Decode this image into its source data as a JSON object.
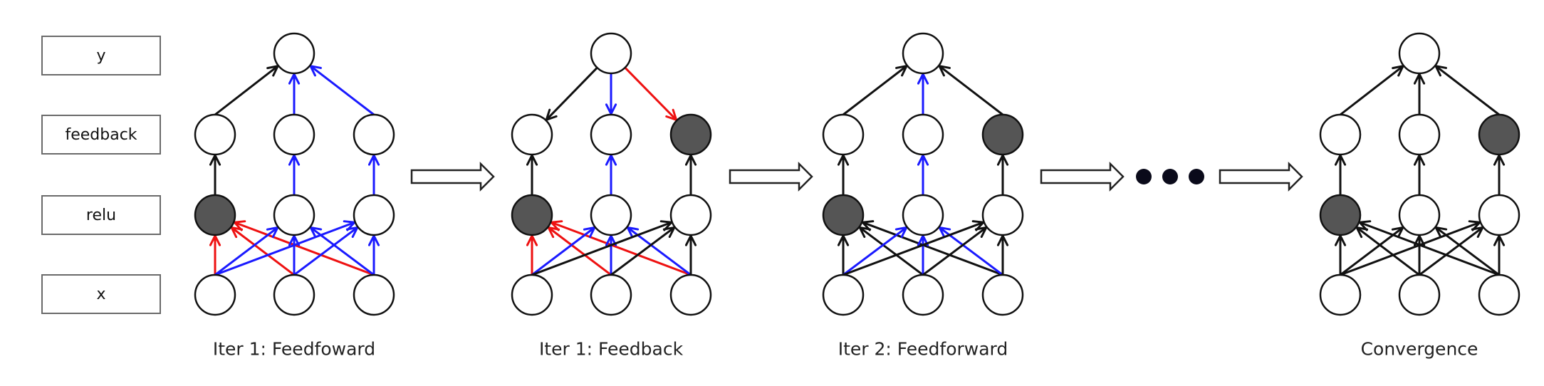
{
  "layers": [
    {
      "id": "y",
      "label": "y"
    },
    {
      "id": "feedback",
      "label": "feedback"
    },
    {
      "id": "relu",
      "label": "relu"
    },
    {
      "id": "x",
      "label": "x"
    }
  ],
  "colors": {
    "inactive_edge": "#111111",
    "active_edge": "#1a1aff",
    "suppressed_edge": "#ee1111",
    "node_stroke": "#111111",
    "node_empty": "#ffffff",
    "node_deactivated": "#555555",
    "ellipsis_dot": "#0a0a1a"
  },
  "stages": [
    {
      "caption": "Iter 1: Feedfoward",
      "deactivated": {
        "relu": [
          0
        ],
        "feedback": []
      },
      "x_to_relu": [
        [
          "red",
          "red",
          "red"
        ],
        [
          "blue",
          "blue",
          "blue"
        ],
        [
          "blue",
          "blue",
          "blue"
        ]
      ],
      "relu_to_feedback": [
        "black",
        "blue",
        "blue"
      ],
      "feedback_y": {
        "direction": "up",
        "colors": [
          "black",
          "blue",
          "blue"
        ]
      }
    },
    {
      "caption": "Iter 1: Feedback",
      "deactivated": {
        "relu": [
          0
        ],
        "feedback": [
          2
        ]
      },
      "x_to_relu": [
        [
          "red",
          "red",
          "red"
        ],
        [
          "blue",
          "blue",
          "blue"
        ],
        [
          "black",
          "black",
          "black"
        ]
      ],
      "relu_to_feedback": [
        "black",
        "blue",
        "black"
      ],
      "feedback_y": {
        "direction": "down",
        "colors": [
          "black",
          "blue",
          "red"
        ]
      }
    },
    {
      "caption": "Iter 2: Feedforward",
      "deactivated": {
        "relu": [
          0
        ],
        "feedback": [
          2
        ]
      },
      "x_to_relu": [
        [
          "black",
          "black",
          "black"
        ],
        [
          "blue",
          "blue",
          "blue"
        ],
        [
          "black",
          "black",
          "black"
        ]
      ],
      "relu_to_feedback": [
        "black",
        "blue",
        "black"
      ],
      "feedback_y": {
        "direction": "up",
        "colors": [
          "black",
          "blue",
          "black"
        ]
      }
    },
    {
      "caption": "Convergence",
      "deactivated": {
        "relu": [
          0
        ],
        "feedback": [
          2
        ]
      },
      "x_to_relu": [
        [
          "black",
          "black",
          "black"
        ],
        [
          "black",
          "black",
          "black"
        ],
        [
          "black",
          "black",
          "black"
        ]
      ],
      "relu_to_feedback": [
        "black",
        "black",
        "black"
      ],
      "feedback_y": {
        "direction": "up",
        "colors": [
          "black",
          "black",
          "black"
        ]
      }
    }
  ],
  "transitions": [
    {
      "type": "block-arrow"
    },
    {
      "type": "block-arrow"
    },
    {
      "type": "block-arrow"
    },
    {
      "type": "ellipsis",
      "dots": 3
    },
    {
      "type": "block-arrow"
    }
  ]
}
